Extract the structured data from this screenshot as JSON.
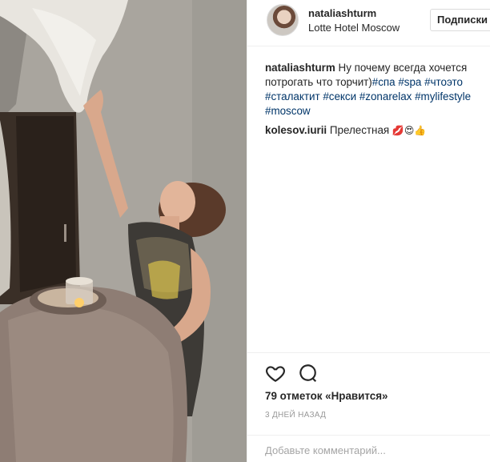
{
  "post": {
    "username": "nataliashturm",
    "location": "Lotte Hotel Moscow",
    "follow_label": "Подписки",
    "caption": {
      "user": "nataliashturm",
      "text": " Ну почему всегда хочется потрогать что торчит)",
      "hashtags": [
        "#спа",
        "#spa",
        "#чтоэто",
        "#сталактит",
        "#секси",
        "#zonarelax",
        "#mylifestyle",
        "#moscow"
      ]
    },
    "comments": [
      {
        "user": "kolesov.iurii",
        "text": "Прелестная",
        "emoji": "💋😍👍"
      }
    ],
    "likes_text": "79 отметок «Нравится»",
    "time_ago": "3 ДНЕЙ НАЗАД",
    "comment_placeholder": "Добавьте комментарий...",
    "icons": {
      "like": "heart-outline-icon",
      "comment": "speech-bubble-icon"
    },
    "colors": {
      "hashtag": "#003569",
      "text": "#262626",
      "muted": "#999999",
      "border": "#efefef"
    }
  }
}
